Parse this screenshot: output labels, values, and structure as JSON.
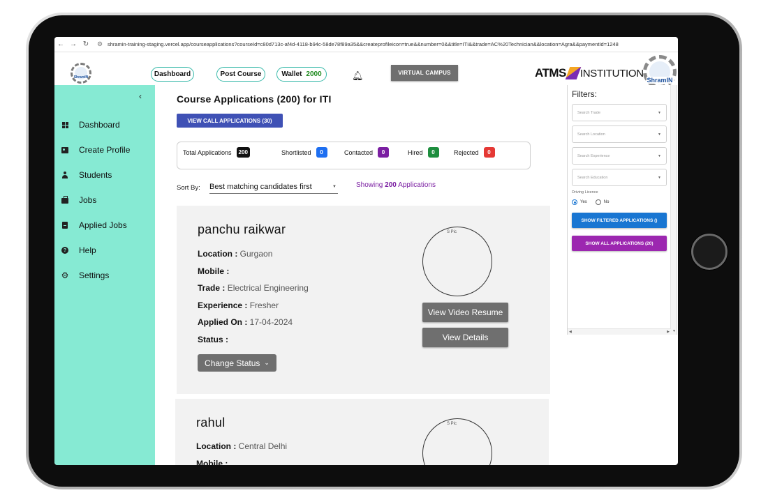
{
  "browser": {
    "url": "shramin-training-staging.vercel.app/courseapplications?courseId=c80d713c-af4d-4118-b94c-58de78f89a35&&createprofileicon=true&&number=0&&title=ITI&&trade=AC%20Technician&&location=Agra&&paymentId=1248"
  },
  "header": {
    "logo_text": "ShramIN",
    "dashboard_label": "Dashboard",
    "post_course_label": "Post Course",
    "wallet_label": "Wallet",
    "wallet_amount": "2000",
    "virtual_campus_label": "VIRTUAL CAMPUS",
    "brand_atms": "ATMS",
    "brand_institutions": "INSTITUTIONS"
  },
  "sidebar": {
    "collapse_icon": "chevron-left-icon",
    "items": [
      {
        "label": "Dashboard",
        "icon": "dashboard-icon"
      },
      {
        "label": "Create Profile",
        "icon": "id-card-icon"
      },
      {
        "label": "Students",
        "icon": "person-icon"
      },
      {
        "label": "Jobs",
        "icon": "briefcase-icon"
      },
      {
        "label": "Applied Jobs",
        "icon": "document-icon"
      },
      {
        "label": "Help",
        "icon": "help-icon"
      },
      {
        "label": "Settings",
        "icon": "gear-icon"
      }
    ]
  },
  "main": {
    "title": "Course Applications (200) for ITI",
    "call_applications_button": "VIEW CALL APPLICATIONS (30)",
    "stats": [
      {
        "label": "Total Applications",
        "value": "200",
        "color": "#111111"
      },
      {
        "label": "Shortlisted",
        "value": "0",
        "color": "#1e6ff1"
      },
      {
        "label": "Contacted",
        "value": "0",
        "color": "#7b1fa2"
      },
      {
        "label": "Hired",
        "value": "0",
        "color": "#1e8e3e"
      },
      {
        "label": "Rejected",
        "value": "0",
        "color": "#e53935"
      }
    ],
    "sort_by_label": "Sort By:",
    "sort_value": "Best matching candidates first",
    "showing_prefix": "Showing",
    "showing_count": "200",
    "showing_suffix": "Applications",
    "candidates": [
      {
        "name": "panchu raikwar",
        "location_label": "Location :",
        "location": "Gurgaon",
        "mobile_label": "Mobile :",
        "mobile": "",
        "trade_label": "Trade :",
        "trade": "Electrical Engineering",
        "experience_label": "Experience :",
        "experience": "Fresher",
        "applied_label": "Applied On :",
        "applied_on": "17-04-2024",
        "status_label": "Status :",
        "status": "",
        "photo_alt": "S Pic",
        "video_button": "View Video Resume",
        "details_button": "View Details",
        "change_status_button": "Change Status"
      },
      {
        "name": "rahul",
        "location_label": "Location :",
        "location": "Central Delhi",
        "mobile_label": "Mobile :",
        "mobile": "",
        "photo_alt": "S Pic"
      }
    ]
  },
  "filters": {
    "title": "Filters:",
    "trade_placeholder": "Search Trade",
    "location_placeholder": "Search Location",
    "experience_placeholder": "Search Experience",
    "education_placeholder": "Search Education",
    "driving_licence_label": "Driving Licence",
    "yes_label": "Yes",
    "no_label": "No",
    "selected_licence": "Yes",
    "show_filtered_button": "SHOW FILTERED APPLICATIONS ()",
    "show_all_button": "SHOW ALL APPLICATIONS (20)",
    "filtered_button_color": "#1976d2",
    "all_button_color": "#9c27b0"
  },
  "colors": {
    "sidebar_bg": "#86ead3",
    "accent_blue": "#3f51b5",
    "pill_border": "#37b9a9"
  }
}
